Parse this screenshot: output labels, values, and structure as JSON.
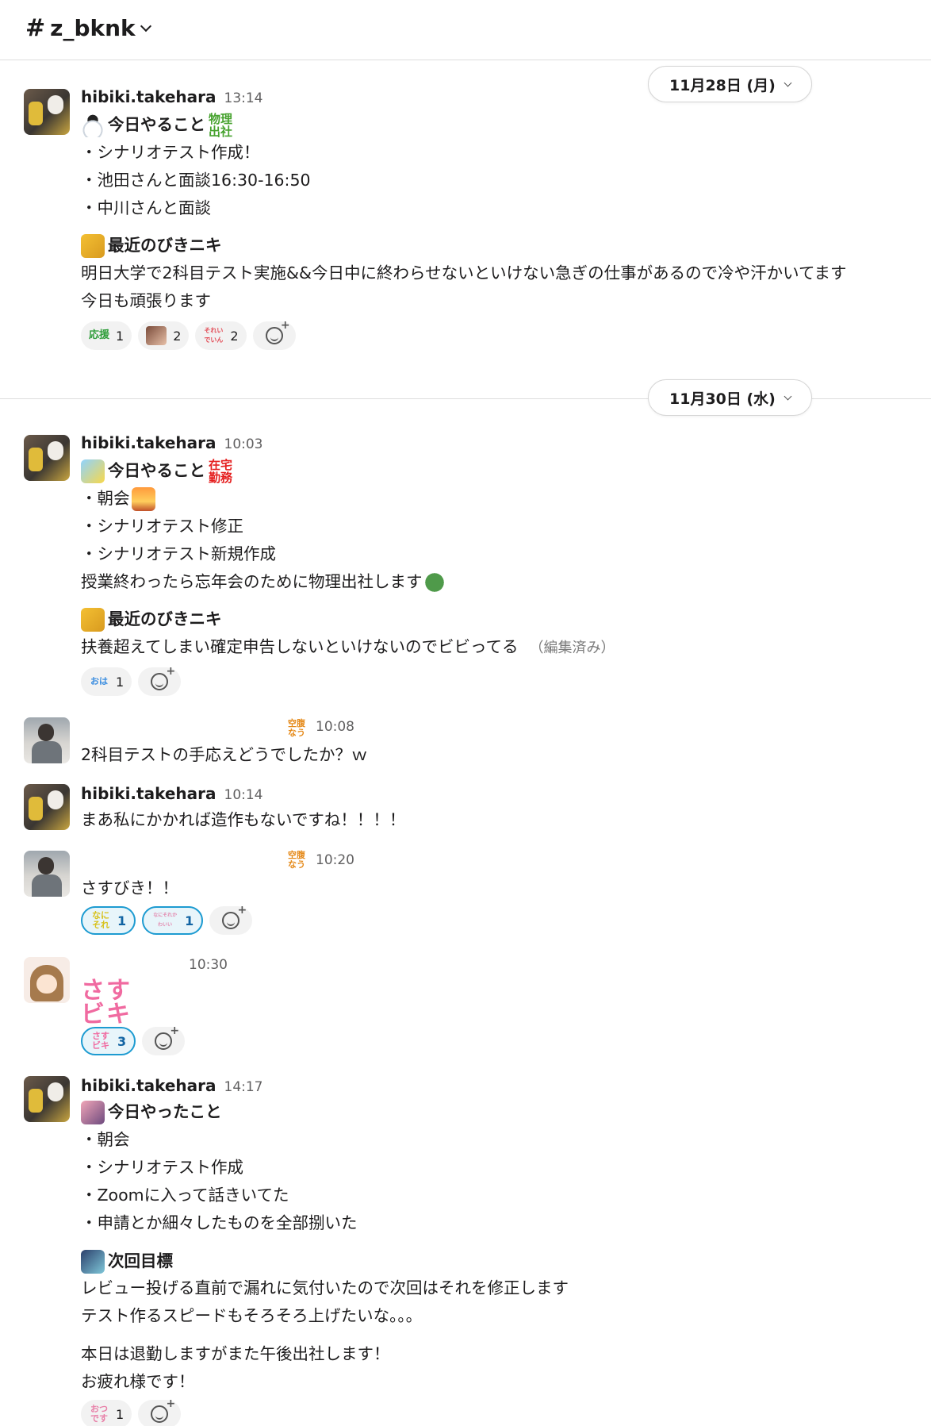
{
  "header": {
    "channel_prefix": "#",
    "channel_name": "z_bknk"
  },
  "dates": {
    "d1": "11月28日 (月)",
    "d2": "11月30日 (水)"
  },
  "messages": {
    "m1": {
      "user": "hibiki.takehara",
      "time": "13:14",
      "heading1": "今日やること",
      "tag1a": "物理",
      "tag1b": "出社",
      "items": [
        "・シナリオテスト作成！",
        "・池田さんと面談16:30-16:50",
        "・中川さんと面談"
      ],
      "heading2": "最近のびきニキ",
      "body": [
        "明日大学で2科目テスト実施&&今日中に終わらせないといけない急ぎの仕事があるので冷や汗かいてます",
        "今日も頑張ります"
      ],
      "reactions": [
        {
          "icon": "応援",
          "count": "1"
        },
        {
          "icon": "",
          "count": "2"
        },
        {
          "icon": "それいでいん",
          "count": "2"
        }
      ]
    },
    "m2": {
      "user": "hibiki.takehara",
      "time": "10:03",
      "heading1": "今日やること",
      "tag1a": "在宅",
      "tag1b": "勤務",
      "items": [
        "・朝会",
        "・シナリオテスト修正",
        "・シナリオテスト新規作成"
      ],
      "note": "授業終わったら忘年会のために物理出社します",
      "heading2": "最近のびきニキ",
      "body": "扶養超えてしまい確定申告しないといけないのでビビってる",
      "edited": "（編集済み）",
      "reactions": [
        {
          "icon": "おは",
          "count": "1"
        }
      ]
    },
    "m3": {
      "status": "空腹なう",
      "time": "10:08",
      "body": "2科目テストの手応えどうでしたか？ｗ"
    },
    "m4": {
      "user": "hibiki.takehara",
      "time": "10:14",
      "body": "まあ私にかかれば造作もないですね！！！！"
    },
    "m5": {
      "status": "空腹なう",
      "time": "10:20",
      "body": "さすびき！！",
      "reactions": [
        {
          "icon": "なにそれ",
          "count": "1"
        },
        {
          "icon": "なにそれかわいい",
          "count": "1"
        }
      ]
    },
    "m6": {
      "time": "10:30",
      "big_line1": "さす",
      "big_line2": "ビキ",
      "reactions": [
        {
          "icon": "さすビキ",
          "count": "3"
        }
      ]
    },
    "m7": {
      "user": "hibiki.takehara",
      "time": "14:17",
      "heading1": "今日やったこと",
      "items": [
        "・朝会",
        "・シナリオテスト作成",
        "・Zoomに入って話きいてた",
        "・申請とか細々したものを全部捌いた"
      ],
      "heading2": "次回目標",
      "goals": [
        "レビュー投げる直前で漏れに気付いたので次回はそれを修正します",
        "テスト作るスピードもそろそろ上げたいな。。。"
      ],
      "closing": [
        "本日は退勤しますがまた午後出社します！",
        "お疲れ様です！"
      ],
      "reactions": [
        {
          "icon": "おつです",
          "count": "1"
        }
      ]
    }
  },
  "colors": {
    "accent_blue": "#1d9bd1",
    "text": "#1d1c1d",
    "muted": "#616061",
    "pink": "#f06aa0"
  }
}
